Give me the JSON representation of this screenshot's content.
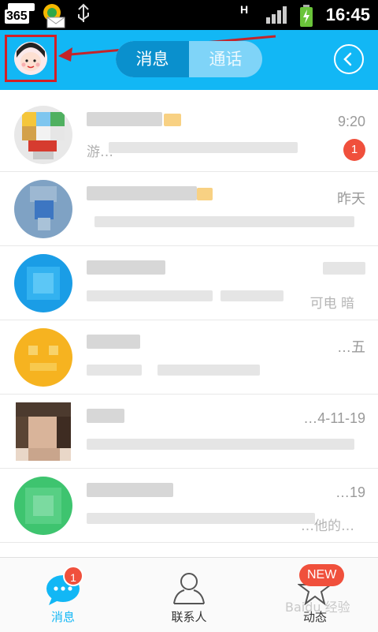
{
  "status_bar": {
    "left_badge": "365",
    "network": "H",
    "time": "16:45"
  },
  "header": {
    "tab_messages": "消息",
    "tab_calls": "通话",
    "back_icon": "chevron-left-icon"
  },
  "messages": [
    {
      "time": "9:20",
      "badge": "1",
      "snippet": "游…"
    },
    {
      "time": "昨天",
      "badge": "",
      "snippet": ""
    },
    {
      "time": "",
      "badge": "",
      "snippet": "",
      "snippet_right": "可电 暗"
    },
    {
      "time": "…五",
      "badge": "",
      "snippet": ""
    },
    {
      "time": "…4-11-19",
      "badge": "",
      "snippet": ""
    },
    {
      "time": "…19",
      "badge": "",
      "snippet": "",
      "snippet_right": "…他的…"
    }
  ],
  "tabbar": {
    "messages_label": "消息",
    "messages_badge": "1",
    "contacts_label": "联系人",
    "moments_label": "动态",
    "moments_badge": "NEW"
  },
  "watermark": "Baidu 经验",
  "colors": {
    "header_bg": "#12b7f5",
    "active_tab": "#0a90cd",
    "badge": "#f0503c",
    "annotation": "#d31f25"
  }
}
